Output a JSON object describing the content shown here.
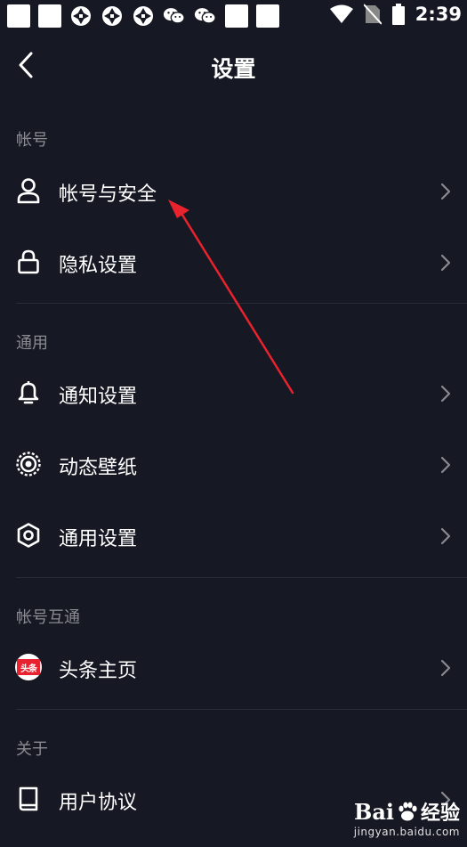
{
  "status_bar": {
    "time": "2:39"
  },
  "nav": {
    "title": "设置"
  },
  "sections": {
    "account": "帐号",
    "general": "通用",
    "interop": "帐号互通",
    "about": "关于"
  },
  "rows": {
    "account_security": "帐号与安全",
    "privacy": "隐私设置",
    "notifications": "通知设置",
    "live_wallpaper": "动态壁纸",
    "general_settings": "通用设置",
    "toutiao_home": "头条主页",
    "user_agreement": "用户协议"
  },
  "icons": {
    "toutiao_badge": "头条"
  },
  "watermark": {
    "logo": "Bai",
    "logo_tail": "经验",
    "url": "jingyan.baidu.com"
  },
  "colors": {
    "background": "#161823",
    "annotation_arrow": "#e8232e"
  }
}
